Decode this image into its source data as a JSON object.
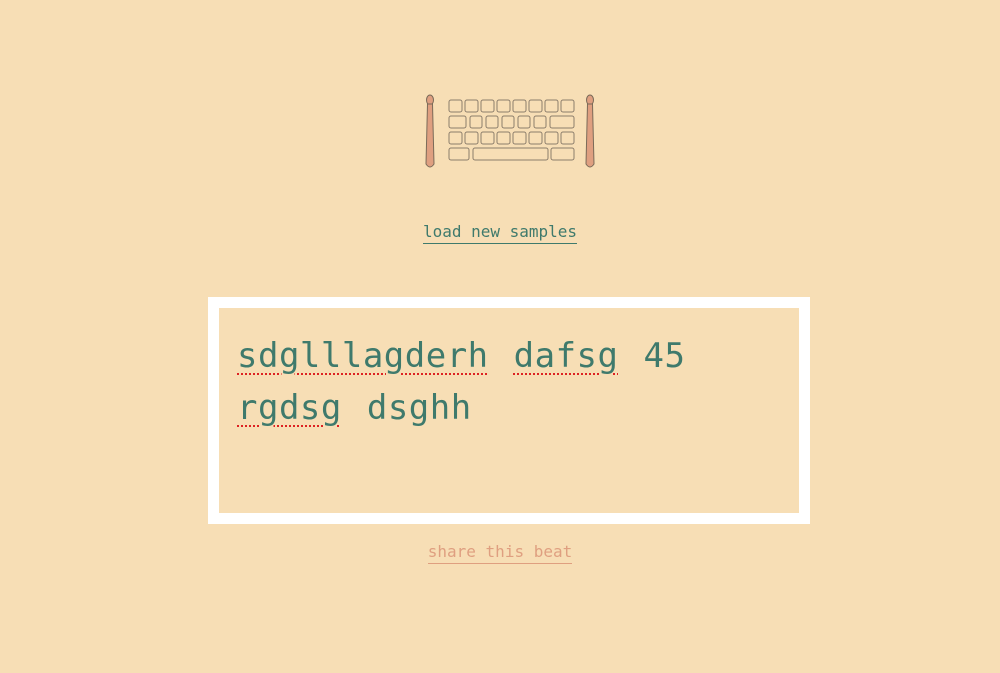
{
  "logo": {
    "icon": "keyboard-drumsticks-icon"
  },
  "load_link": {
    "label": "load new samples"
  },
  "editor": {
    "words": [
      {
        "text": "sdglllagderh",
        "misspelled": true
      },
      {
        "text": "dafsg",
        "misspelled": true
      },
      {
        "text": "45",
        "misspelled": false
      },
      {
        "text": "rgdsg",
        "misspelled": true
      },
      {
        "text": "dsghh",
        "misspelled": false
      }
    ]
  },
  "share_link": {
    "label": "share this beat"
  },
  "colors": {
    "background": "#f7deb5",
    "text_teal": "#3f7a6c",
    "link_salmon": "#df9f80",
    "frame": "#ffffff",
    "spell_underline": "#dd2222"
  }
}
